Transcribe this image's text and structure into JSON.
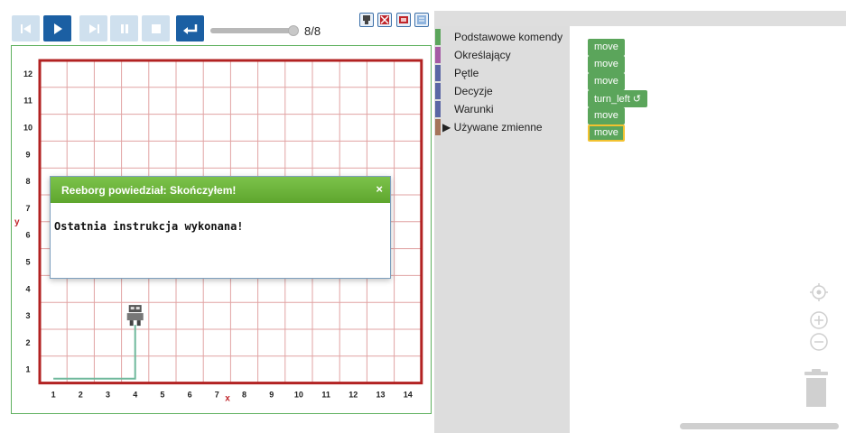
{
  "toolbar": {
    "buttons": [
      "reload-icon",
      "play-icon",
      "step-icon",
      "pause-icon",
      "stop-icon",
      "return-icon"
    ],
    "progress": 1.0,
    "step_counter": "8/8",
    "right_icons": [
      "robot-icon",
      "world-icon",
      "flag-icon",
      "editor-icon"
    ]
  },
  "world": {
    "x_axis_label": "x",
    "y_axis_label": "y",
    "x_ticks": [
      "1",
      "2",
      "3",
      "4",
      "5",
      "6",
      "7",
      "8",
      "9",
      "10",
      "11",
      "12",
      "13",
      "14"
    ],
    "y_ticks": [
      "1",
      "2",
      "3",
      "4",
      "5",
      "6",
      "7",
      "8",
      "9",
      "10",
      "11",
      "12"
    ],
    "robot_position": [
      4,
      3
    ],
    "trail": [
      [
        1,
        1
      ],
      [
        4,
        1
      ],
      [
        4,
        3
      ]
    ],
    "colors": {
      "grid": "#e1a3a3",
      "wall": "#b22222",
      "trail": "#6fb89c"
    }
  },
  "dialog": {
    "title": "Reeborg powiedział: Skończyłem!",
    "close": "×",
    "message": "Ostatnia instrukcja wykonana!"
  },
  "toolbox": {
    "categories": [
      {
        "label": "Podstawowe komendy",
        "color": "#5ba55b"
      },
      {
        "label": "Określający",
        "color": "#a55ba5"
      },
      {
        "label": "Pętle",
        "color": "#5b67a5"
      },
      {
        "label": "Decyzje",
        "color": "#5b67a5"
      },
      {
        "label": "Warunki",
        "color": "#5b67a5"
      },
      {
        "label": "▶ Używane zmienne",
        "color": "#a5745b"
      }
    ]
  },
  "program": {
    "blocks": [
      "move",
      "move",
      "move",
      "turn_left ↺",
      "move",
      "move"
    ],
    "block_color": "#5ba55b",
    "selected_index": 5
  }
}
